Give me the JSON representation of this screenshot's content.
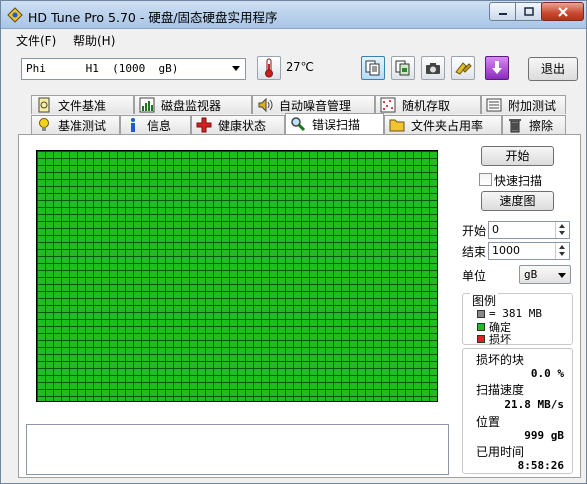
{
  "window": {
    "title": "HD Tune Pro 5.70 - 硬盘/固态硬盘实用程序"
  },
  "menu": [
    {
      "label": "文件(F)"
    },
    {
      "label": "帮助(H)"
    }
  ],
  "toolbar": {
    "drive": "Phi      H1  (1000  gB)",
    "temperature": "27℃",
    "exit_label": "退出",
    "buttons": [
      "copy-text-icon",
      "copy-screenshot-icon",
      "camera-icon",
      "options-icon",
      "download-icon"
    ]
  },
  "tabs_top": [
    {
      "label": "文件基准",
      "icon": "file-benchmark-icon"
    },
    {
      "label": "磁盘监视器",
      "icon": "disk-monitor-icon"
    },
    {
      "label": "自动噪音管理",
      "icon": "speaker-icon"
    },
    {
      "label": "随机存取",
      "icon": "random-access-icon"
    },
    {
      "label": "附加测试",
      "icon": "extra-tests-icon"
    }
  ],
  "tabs_bottom": [
    {
      "label": "基准测试",
      "icon": "bulb-icon"
    },
    {
      "label": "信息",
      "icon": "info-icon"
    },
    {
      "label": "健康状态",
      "icon": "health-cross-icon"
    },
    {
      "label": "错误扫描",
      "icon": "magnifier-icon",
      "active": true
    },
    {
      "label": "文件夹占用率",
      "icon": "folder-icon"
    },
    {
      "label": "擦除",
      "icon": "trash-icon"
    }
  ],
  "scan": {
    "start_label": "开始",
    "quick_scan_label": "快速扫描",
    "speed_map_label": "速度图",
    "start_field_label": "开始",
    "start_value": "0",
    "end_field_label": "结束",
    "end_value": "1000",
    "unit_label": "单位",
    "unit_value": "gB",
    "legend_title": "图例",
    "legend": [
      {
        "label": "= 381 MB",
        "color": "#888888"
      },
      {
        "label": "确定",
        "color": "#22bb22"
      },
      {
        "label": "损坏",
        "color": "#dd2222"
      }
    ],
    "stats": {
      "damaged_label": "损坏的块",
      "damaged_value": "0.0 %",
      "speed_label": "扫描速度",
      "speed_value": "21.8 MB/s",
      "position_label": "位置",
      "position_value": "999 gB",
      "elapsed_label": "已用时间",
      "elapsed_value": "8:58:26"
    },
    "block_status": "all-ok",
    "block_color": "#22bb22"
  }
}
